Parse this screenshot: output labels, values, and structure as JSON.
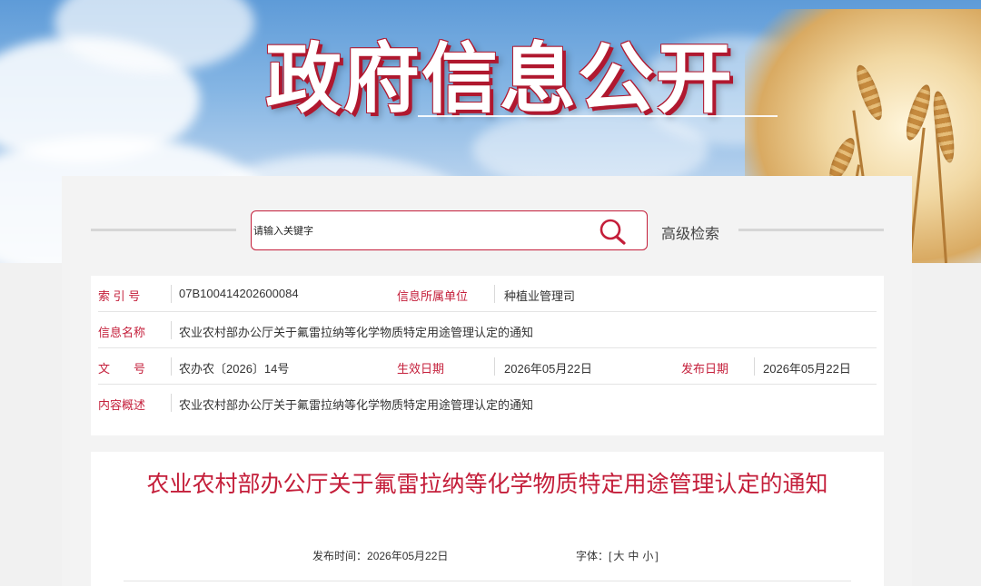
{
  "banner": {
    "title": "政府信息公开"
  },
  "search": {
    "placeholder": "请输入关键字",
    "advanced_label": "高级检索",
    "icon": "search-icon"
  },
  "meta": {
    "index_label": "索 引 号",
    "index_value": "07B100414202600084",
    "unit_label": "信息所属单位",
    "unit_value": "种植业管理司",
    "name_label": "信息名称",
    "name_value": "农业农村部办公厅关于氟雷拉纳等化学物质特定用途管理认定的通知",
    "doc_label": "文　　号",
    "doc_value": "农办农〔2026〕14号",
    "effective_label": "生效日期",
    "effective_value": "2026年05月22日",
    "publish_label": "发布日期",
    "publish_value": "2026年05月22日",
    "summary_label": "内容概述",
    "summary_value": "农业农村部办公厅关于氟雷拉纳等化学物质特定用途管理认定的通知"
  },
  "article": {
    "title": "农业农村部办公厅关于氟雷拉纳等化学物质特定用途管理认定的通知",
    "pub_time_label": "发布时间：",
    "pub_time_value": "2026年05月22日",
    "font_label": "字体：",
    "font_open": "[",
    "font_large": "大",
    "font_medium": "中",
    "font_small": "小",
    "font_close": "]"
  },
  "colors": {
    "accent": "#c41e3a",
    "label": "#c41e3a",
    "text": "#333333"
  }
}
